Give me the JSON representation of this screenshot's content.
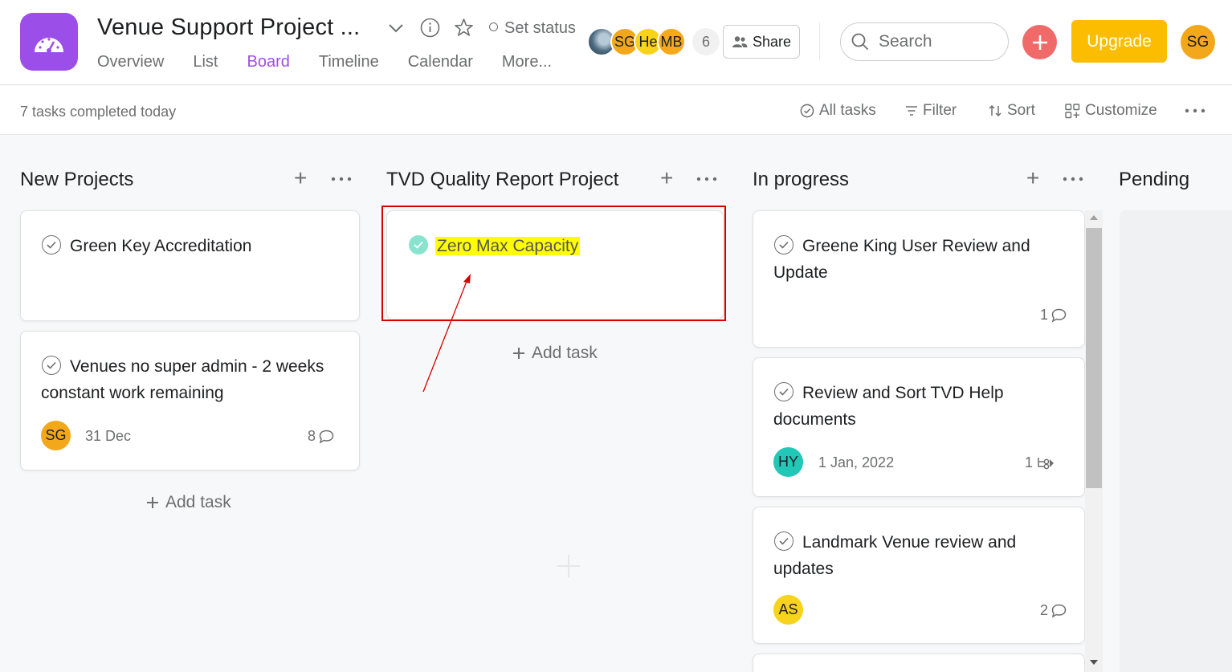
{
  "header": {
    "project_title": "Venue Support Project ...",
    "set_status": "Set status",
    "tabs": [
      "Overview",
      "List",
      "Board",
      "Timeline",
      "Calendar",
      "More..."
    ],
    "active_tab": "Board",
    "avatars": [
      "SG",
      "He",
      "MB"
    ],
    "member_count": "6",
    "share_label": "Share",
    "search_placeholder": "Search",
    "upgrade_label": "Upgrade",
    "user_initials": "SG",
    "accent_color": "#9c4ee8"
  },
  "toolbar": {
    "completed_today": "7 tasks completed today",
    "all_tasks": "All tasks",
    "filter": "Filter",
    "sort": "Sort",
    "customize": "Customize"
  },
  "board": {
    "columns": [
      {
        "title": "New Projects",
        "cards": [
          {
            "title": "Green Key Accreditation"
          },
          {
            "title": "Venues no super admin - 2 weeks constant work remaining",
            "assignee": "SG",
            "date": "31 Dec",
            "comments": "8"
          }
        ],
        "add_task": "Add task"
      },
      {
        "title": "TVD Quality Report Project",
        "cards": [
          {
            "title": "Zero Max Capacity",
            "completed": true
          }
        ],
        "add_task": "Add task"
      },
      {
        "title": "In progress",
        "cards": [
          {
            "title": "Greene King User Review and Update",
            "comments": "1"
          },
          {
            "title": "Review and Sort TVD Help documents",
            "assignee": "HY",
            "date": "1 Jan, 2022",
            "subtasks": "1"
          },
          {
            "title": "Landmark Venue review and updates",
            "assignee": "AS",
            "comments": "2"
          }
        ]
      },
      {
        "title": "Pending"
      }
    ]
  }
}
